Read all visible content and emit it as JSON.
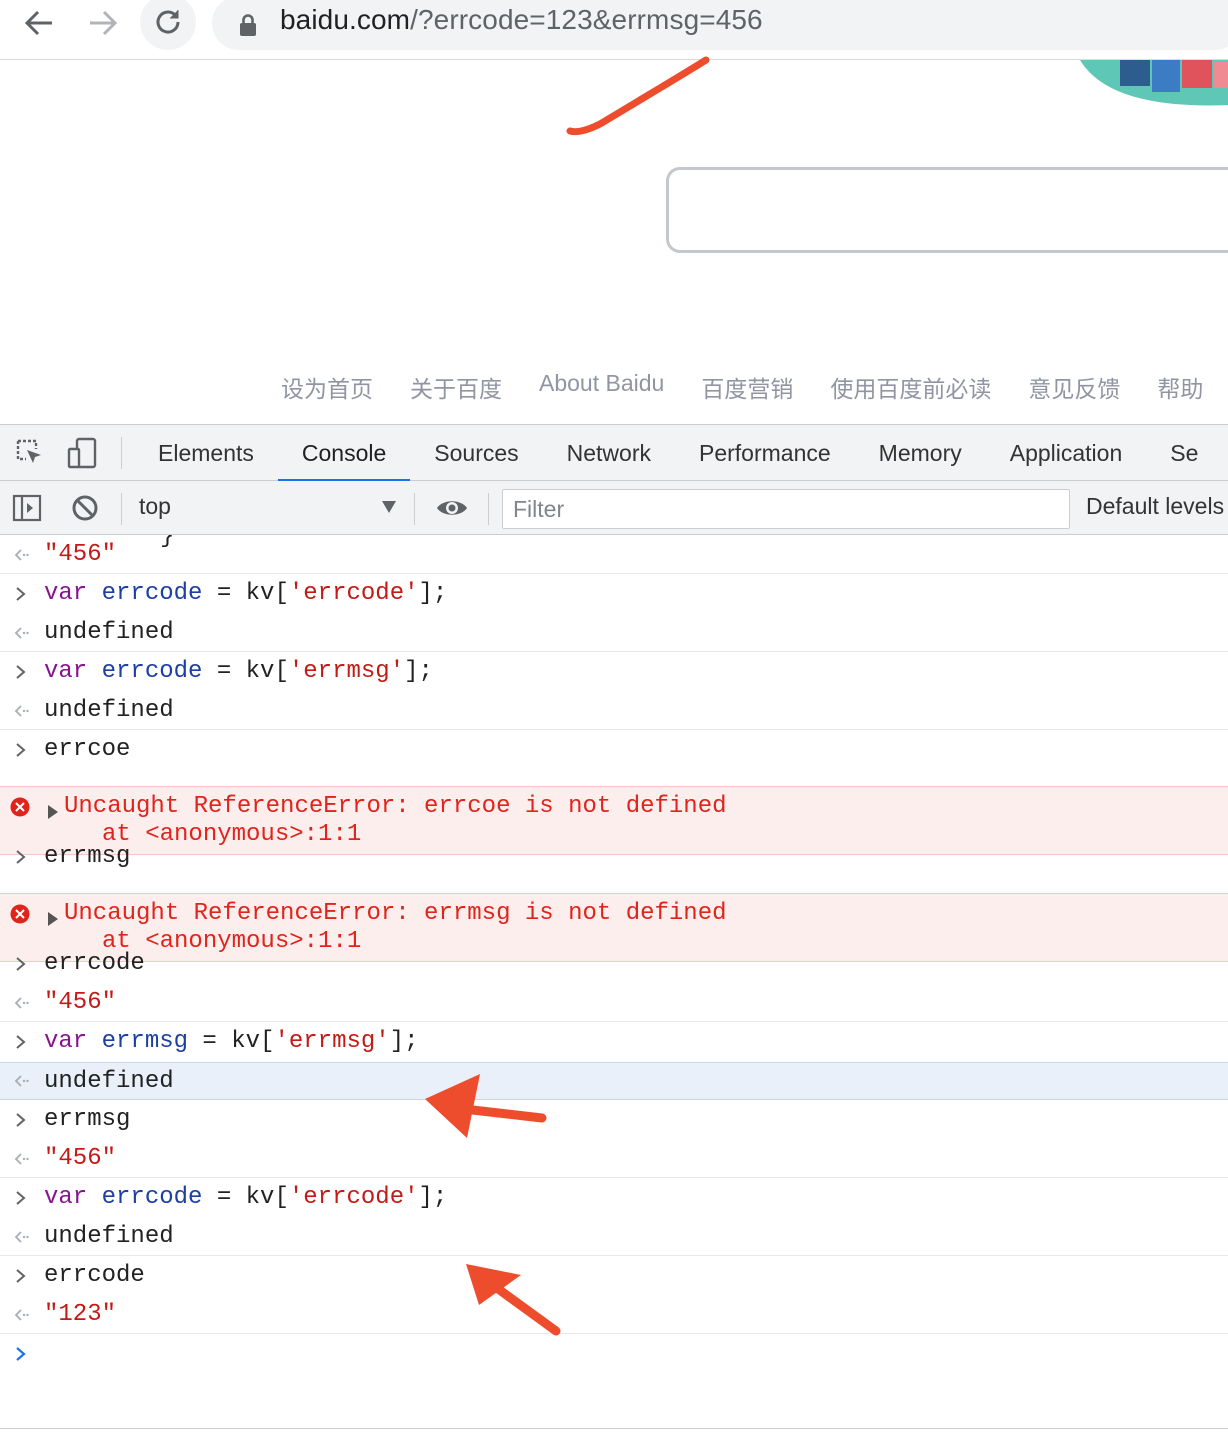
{
  "browser": {
    "url_host": "baidu.com",
    "url_rest": "/?errcode=123&errmsg=456"
  },
  "page": {
    "footer_links": [
      "设为首页",
      "关于百度",
      "About Baidu",
      "百度营销",
      "使用百度前必读",
      "意见反馈",
      "帮助"
    ]
  },
  "devtools": {
    "tabs": [
      "Elements",
      "Console",
      "Sources",
      "Network",
      "Performance",
      "Memory",
      "Application",
      "Se"
    ],
    "active_tab": "Console",
    "context": "top",
    "filter_placeholder": "Filter",
    "levels": "Default levels"
  },
  "console": {
    "brace_fragment": "}",
    "lines": [
      {
        "kind": "result",
        "tokens": [
          {
            "t": "\"456\"",
            "c": "str"
          }
        ]
      },
      {
        "kind": "input",
        "tokens": [
          {
            "t": "var ",
            "c": "kw"
          },
          {
            "t": "errcode",
            "c": "vn"
          },
          {
            "t": " = ",
            "c": "op"
          },
          {
            "t": "kv[",
            "c": "pl"
          },
          {
            "t": "'errcode'",
            "c": "str"
          },
          {
            "t": "];",
            "c": "pl"
          }
        ]
      },
      {
        "kind": "result",
        "tokens": [
          {
            "t": "undefined",
            "c": "pl"
          }
        ]
      },
      {
        "kind": "input",
        "tokens": [
          {
            "t": "var ",
            "c": "kw"
          },
          {
            "t": "errcode",
            "c": "vn"
          },
          {
            "t": " = ",
            "c": "op"
          },
          {
            "t": "kv[",
            "c": "pl"
          },
          {
            "t": "'errmsg'",
            "c": "str"
          },
          {
            "t": "];",
            "c": "pl"
          }
        ]
      },
      {
        "kind": "result",
        "tokens": [
          {
            "t": "undefined",
            "c": "pl"
          }
        ]
      },
      {
        "kind": "input",
        "tokens": [
          {
            "t": "errcoe",
            "c": "pl"
          }
        ]
      },
      {
        "kind": "error",
        "line1": "Uncaught ReferenceError: errcoe is not defined",
        "line2": "at <anonymous>:1:1"
      },
      {
        "kind": "input",
        "tokens": [
          {
            "t": "errmsg",
            "c": "pl"
          }
        ]
      },
      {
        "kind": "error",
        "line1": "Uncaught ReferenceError: errmsg is not defined",
        "line2": "at <anonymous>:1:1"
      },
      {
        "kind": "input",
        "tokens": [
          {
            "t": "errcode",
            "c": "pl"
          }
        ]
      },
      {
        "kind": "result",
        "tokens": [
          {
            "t": "\"456\"",
            "c": "str"
          }
        ]
      },
      {
        "kind": "input",
        "tokens": [
          {
            "t": "var ",
            "c": "kw"
          },
          {
            "t": "errmsg",
            "c": "vn"
          },
          {
            "t": " = ",
            "c": "op"
          },
          {
            "t": "kv[",
            "c": "pl"
          },
          {
            "t": "'errmsg'",
            "c": "str"
          },
          {
            "t": "];",
            "c": "pl"
          }
        ]
      },
      {
        "kind": "result",
        "selected": true,
        "tokens": [
          {
            "t": "undefined",
            "c": "pl"
          }
        ]
      },
      {
        "kind": "input",
        "tokens": [
          {
            "t": "errmsg",
            "c": "pl"
          }
        ]
      },
      {
        "kind": "result",
        "tokens": [
          {
            "t": "\"456\"",
            "c": "str"
          }
        ]
      },
      {
        "kind": "input",
        "tokens": [
          {
            "t": "var ",
            "c": "kw"
          },
          {
            "t": "errcode",
            "c": "vn"
          },
          {
            "t": " = ",
            "c": "op"
          },
          {
            "t": "kv[",
            "c": "pl"
          },
          {
            "t": "'errcode'",
            "c": "str"
          },
          {
            "t": "];",
            "c": "pl"
          }
        ]
      },
      {
        "kind": "result",
        "tokens": [
          {
            "t": "undefined",
            "c": "pl"
          }
        ]
      },
      {
        "kind": "input",
        "tokens": [
          {
            "t": "errcode",
            "c": "pl"
          }
        ]
      },
      {
        "kind": "result",
        "tokens": [
          {
            "t": "\"123\"",
            "c": "str"
          }
        ]
      }
    ]
  },
  "colors": {
    "annotation": "#ee4d2d",
    "error_text": "#e1241b",
    "keyword": "#881391",
    "variable": "#1d3fa5",
    "string": "#c41a16",
    "active_tab_indicator": "#1a73e8"
  }
}
